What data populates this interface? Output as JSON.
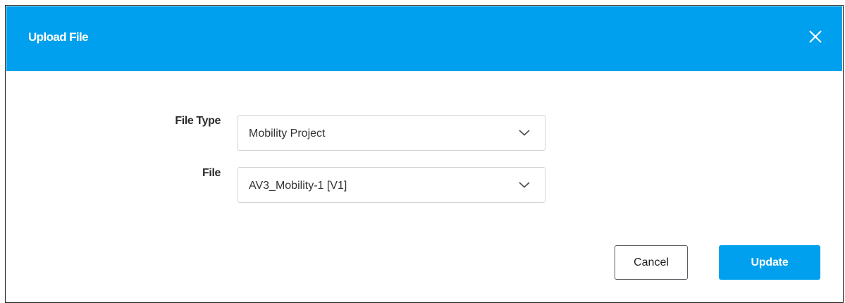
{
  "dialog": {
    "title": "Upload File",
    "close_icon": "close-icon"
  },
  "form": {
    "file_type": {
      "label": "File Type",
      "value": "Mobility Project",
      "icon": "chevron-down-icon"
    },
    "file": {
      "label": "File",
      "value": "AV3_Mobility-1 [V1]",
      "icon": "chevron-down-icon"
    }
  },
  "actions": {
    "cancel_label": "Cancel",
    "update_label": "Update"
  },
  "colors": {
    "header": "#00a0ee",
    "primary_button": "#00a0ee",
    "header_text": "#ffffff"
  }
}
